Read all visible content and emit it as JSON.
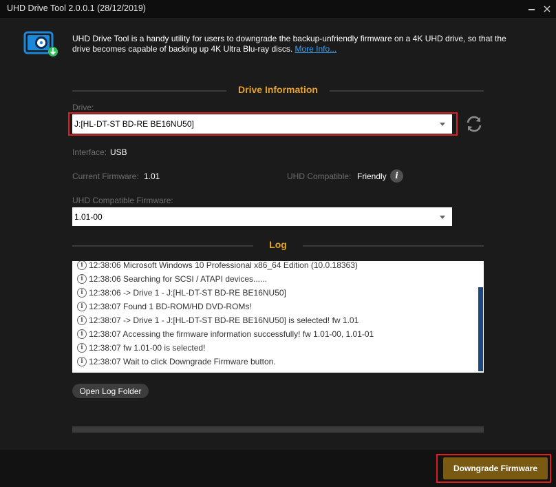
{
  "window": {
    "title": "UHD Drive Tool 2.0.0.1 (28/12/2019)"
  },
  "intro": {
    "text": "UHD Drive Tool is a handy utility for users to downgrade the backup-unfriendly firmware on a 4K UHD drive, so that the drive becomes capable of backing up 4K Ultra Blu-ray discs.",
    "link": "More Info..."
  },
  "drive_info": {
    "heading": "Drive Information",
    "drive_label": "Drive:",
    "drive_value": "J:[HL-DT-ST BD-RE  BE16NU50]",
    "interface_label": "Interface:",
    "interface_value": "USB",
    "firmware_label": "Current Firmware:",
    "firmware_value": "1.01",
    "compat_label": "UHD Compatible:",
    "compat_value": "Friendly",
    "compat_fw_label": "UHD Compatible Firmware:",
    "compat_fw_value": "1.01-00"
  },
  "log": {
    "heading": "Log",
    "entries": [
      "12:38:06 Microsoft Windows 10 Professional x86_64 Edition (10.0.18363)",
      "12:38:06 Searching for SCSI / ATAPI devices......",
      "12:38:06 -> Drive 1 - J:[HL-DT-ST BD-RE BE16NU50]",
      "12:38:07 Found 1 BD-ROM/HD DVD-ROMs!",
      "12:38:07 -> Drive 1 - J:[HL-DT-ST BD-RE BE16NU50] is selected! fw 1.01",
      "12:38:07 Accessing the firmware information successfully! fw 1.01-00, 1.01-01",
      "12:38:07 fw 1.01-00 is selected!",
      "12:38:07 Wait to click Downgrade Firmware button."
    ],
    "open_folder_label": "Open Log Folder"
  },
  "actions": {
    "downgrade_label": "Downgrade Firmware"
  },
  "colors": {
    "accent": "#e6a32a",
    "highlight": "#e01f1f",
    "button": "#7a5a12"
  }
}
